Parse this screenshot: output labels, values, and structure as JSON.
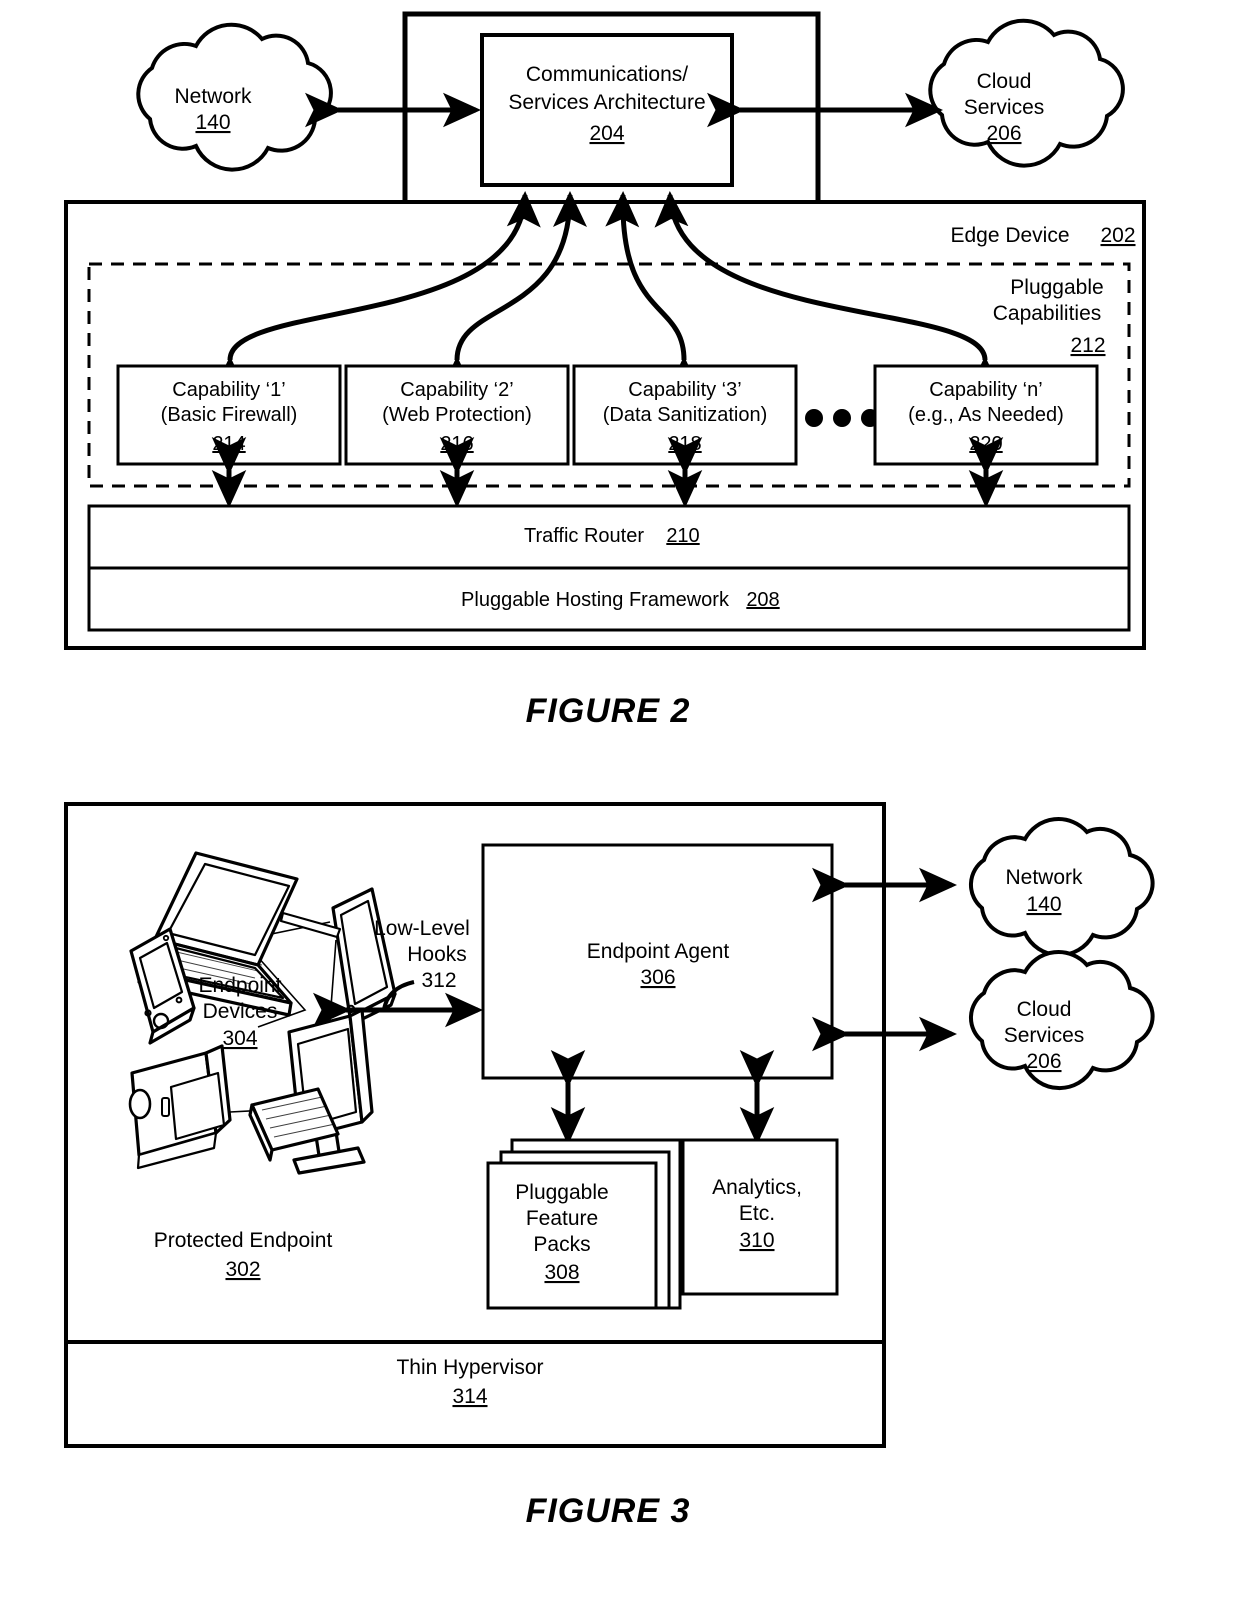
{
  "figure2": {
    "caption": "FIGURE 2",
    "network_cloud": {
      "label": "Network",
      "ref": "140",
      "name": "network-cloud"
    },
    "cloud_services": {
      "label": "Cloud",
      "label2": "Services",
      "ref": "206",
      "name": "cloud-services-cloud"
    },
    "comms_box": {
      "line1": "Communications/",
      "line2": "Services Architecture",
      "ref": "204"
    },
    "edge_device": {
      "label": "Edge Device",
      "ref": "202"
    },
    "pluggable_capabilities": {
      "line1": "Pluggable",
      "line2": "Capabilities",
      "ref": "212"
    },
    "capabilities": [
      {
        "title": "Capability ‘1’",
        "subtitle": "(Basic Firewall)",
        "ref": "214"
      },
      {
        "title": "Capability ‘2’",
        "subtitle": "(Web Protection)",
        "ref": "216"
      },
      {
        "title": "Capability ‘3’",
        "subtitle": "(Data Sanitization)",
        "ref": "218"
      },
      {
        "title": "Capability ‘n’",
        "subtitle": "(e.g., As Needed)",
        "ref": "220"
      }
    ],
    "ellipsis": "• • •",
    "traffic_router": {
      "label": "Traffic Router",
      "ref": "210"
    },
    "hosting_framework": {
      "label": "Pluggable Hosting Framework",
      "ref": "208"
    }
  },
  "figure3": {
    "caption": "FIGURE 3",
    "protected_endpoint": {
      "label": "Protected Endpoint",
      "ref": "302"
    },
    "endpoint_devices": {
      "line1": "Endpoint",
      "line2": "Devices",
      "ref": "304"
    },
    "low_level_hooks": {
      "line1": "Low-Level",
      "line2": "Hooks",
      "ref": "312"
    },
    "endpoint_agent": {
      "label": "Endpoint Agent",
      "ref": "306"
    },
    "feature_packs": {
      "line1": "Pluggable",
      "line2": "Feature",
      "line3": "Packs",
      "ref": "308"
    },
    "analytics": {
      "line1": "Analytics,",
      "line2": "Etc.",
      "ref": "310"
    },
    "thin_hypervisor": {
      "label": "Thin Hypervisor",
      "ref": "314"
    },
    "network_cloud": {
      "label": "Network",
      "ref": "140"
    },
    "cloud_services": {
      "label": "Cloud",
      "label2": "Services",
      "ref": "206"
    }
  },
  "colors": {
    "ink": "#000000",
    "paper": "#ffffff"
  }
}
